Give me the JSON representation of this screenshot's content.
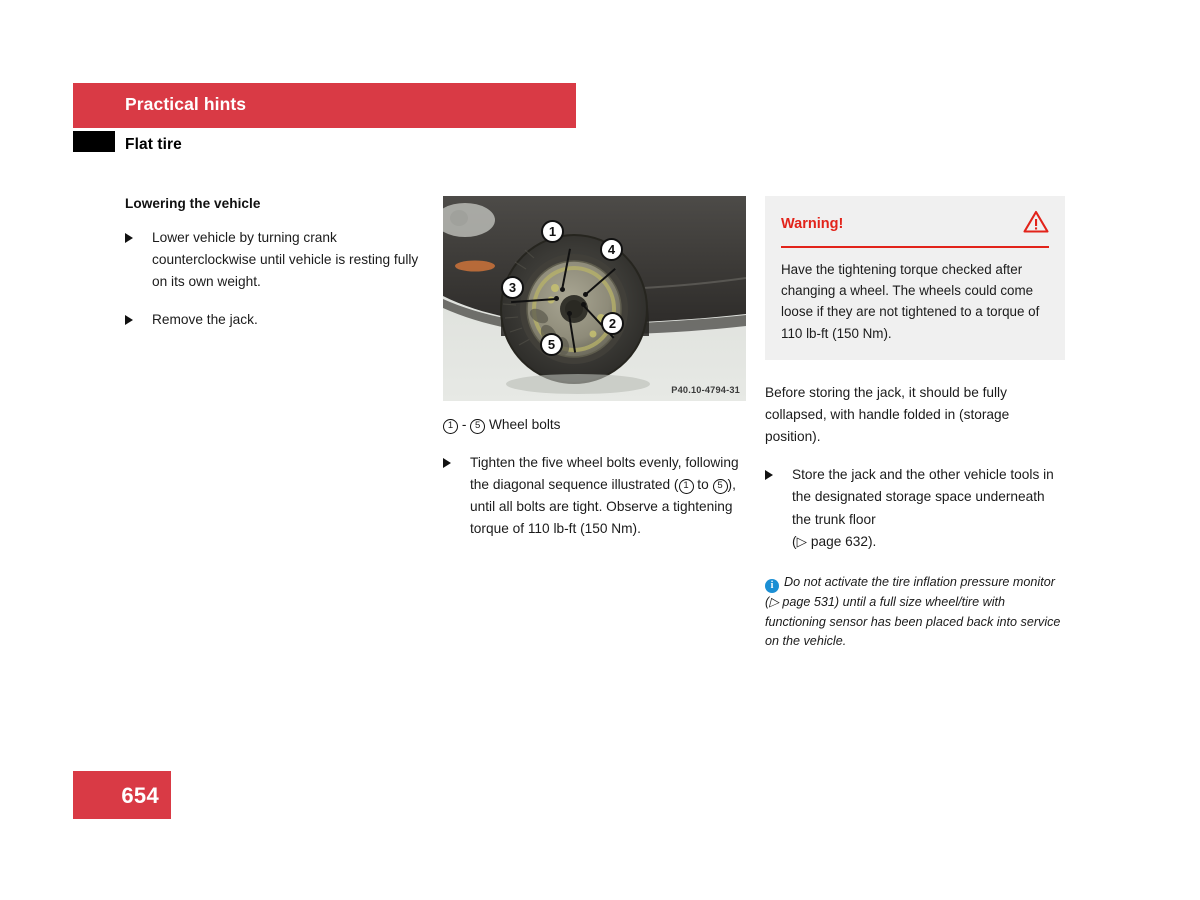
{
  "header": {
    "title": "Practical hints",
    "subtitle": "Flat tire",
    "bar_color": "#d93a45",
    "block_color": "#000000"
  },
  "left_column": {
    "section_heading": "Lowering the vehicle",
    "bullets": [
      "Lower vehicle by turning crank counterclockwise until vehicle is resting fully on its own weight.",
      "Remove the jack."
    ]
  },
  "middle_column": {
    "figure": {
      "reference": "P40.10-4794-31",
      "alt": "Front wheel of vehicle with five wheel bolts numbered 1 to 5 in diagonal tightening sequence",
      "callouts": [
        {
          "number": "1",
          "label": "wheel-bolt-1"
        },
        {
          "number": "2",
          "label": "wheel-bolt-2"
        },
        {
          "number": "3",
          "label": "wheel-bolt-3"
        },
        {
          "number": "4",
          "label": "wheel-bolt-4"
        },
        {
          "number": "5",
          "label": "wheel-bolt-5"
        }
      ]
    },
    "legend": {
      "from": "1",
      "dash": "-",
      "to": "5",
      "text": "Wheel bolts"
    },
    "bullet_parts": {
      "p1": "Tighten the five wheel bolts evenly, following the diagonal sequence illustrated (",
      "n1": "1",
      "p2": " to ",
      "n2": "5",
      "p3": "), until all bolts are tight. Observe a tightening torque of 110 lb-ft (150 Nm)."
    }
  },
  "right_column": {
    "warning": {
      "title": "Warning!",
      "icon": "warning-triangle-icon",
      "accent_color": "#e2231a",
      "background": "#f0f0f0",
      "body": "Have the tightening torque checked after changing a wheel. The wheels could come loose if they are not tightened to a torque of 110 lb-ft (150 Nm)."
    },
    "paragraph": "Before storing the jack, it should be fully collapsed, with handle folded in (storage position).",
    "bullet": {
      "text_before": "Store the jack and the other vehicle tools in the designated storage space underneath the trunk floor",
      "xref_open": "(",
      "xref_arrow": "▷",
      "xref_text": " page 632",
      "xref_close": ")."
    },
    "note": {
      "icon": "info-icon",
      "icon_glyph": "i",
      "icon_color": "#1b8fd4",
      "part1": "Do not activate the tire inflation pressure monitor (",
      "arrow": "▷",
      "part2": " page 531",
      "part3": ") until a full size wheel/tire with functioning sensor has been placed back into service on the vehicle."
    }
  },
  "footer": {
    "page_number": "654",
    "box_color": "#d93a45"
  }
}
